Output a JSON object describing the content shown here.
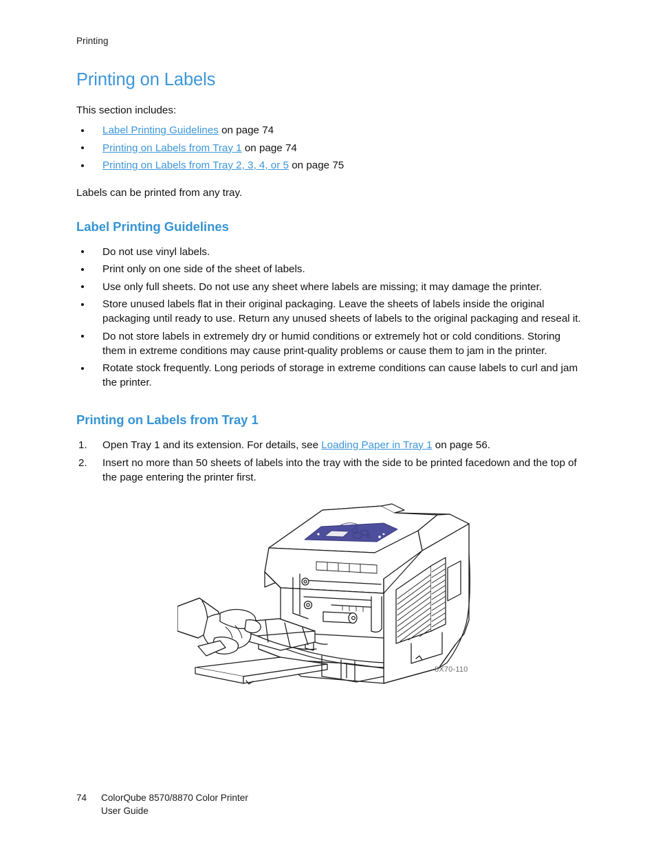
{
  "running_header": "Printing",
  "chapter": {
    "title": "Printing on Labels",
    "intro": "This section includes:",
    "closing": "Labels can be printed from any tray."
  },
  "toc_links": [
    {
      "link_text": "Label Printing Guidelines",
      "suffix": " on page 74"
    },
    {
      "link_text": "Printing on Labels from Tray 1",
      "suffix": " on page 74"
    },
    {
      "link_text": "Printing on Labels from Tray 2, 3, 4, or 5",
      "suffix": " on page 75"
    }
  ],
  "guidelines_section": {
    "title": "Label Printing Guidelines",
    "bullets": [
      "Do not use vinyl labels.",
      "Print only on one side of the sheet of labels.",
      "Use only full sheets. Do not use any sheet where labels are missing; it may damage the printer.",
      "Store unused labels flat in their original packaging. Leave the sheets of labels inside the original packaging until ready to use. Return any unused sheets of labels to the original packaging and reseal it.",
      "Do not store labels in extremely dry or humid conditions or extremely hot or cold conditions. Storing them in extreme conditions may cause print-quality problems or cause them to jam in the printer.",
      "Rotate stock frequently. Long periods of storage in extreme conditions can cause labels to curl and jam the printer."
    ]
  },
  "tray1_section": {
    "title": "Printing on Labels from Tray 1",
    "steps": [
      {
        "number": "1.",
        "prefix": "Open Tray 1 and its extension. For details, see ",
        "link_text": "Loading Paper in Tray 1",
        "suffix": " on page 56."
      },
      {
        "number": "2.",
        "prefix": "Insert no more than 50 sheets of labels into the tray with the side to be printed facedown and the top of the page entering the printer first.",
        "link_text": "",
        "suffix": ""
      }
    ]
  },
  "figure": {
    "caption": "8X70-110",
    "alt": "Line drawing of a ColorQube printer with a hand inserting a stack of labels into the opened Tray 1 at the front of the printer",
    "control_panel_color": "#4e4f9c",
    "line_color": "#1a1a1a"
  },
  "footer": {
    "page_number": "74",
    "product_line": "ColorQube 8570/8870 Color Printer",
    "doc_line": "User Guide"
  },
  "colors": {
    "heading_blue": "#3d96d8",
    "subheading_blue": "#3594d3",
    "link_blue": "#3d96d8",
    "body_text": "#111111",
    "caption_gray": "#6b6b6b"
  }
}
